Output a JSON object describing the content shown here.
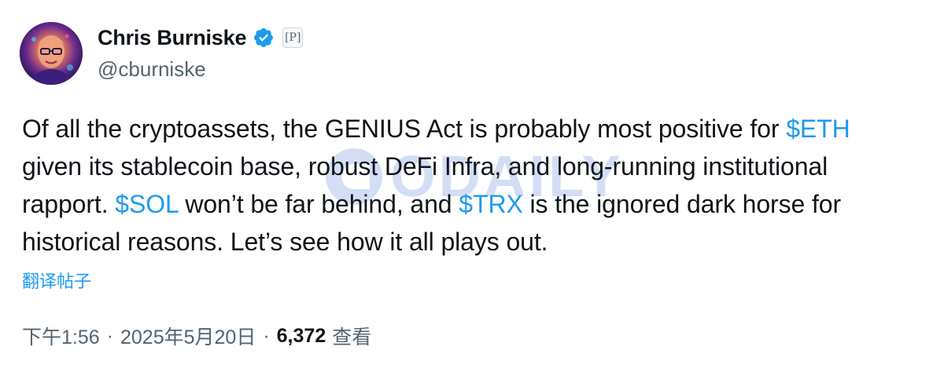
{
  "author": {
    "display_name": "Chris Burniske",
    "handle": "@cburniske",
    "badge_letter": "P",
    "avatar_icon": "profile-photo"
  },
  "tweet": {
    "segments": [
      {
        "text": "Of all the cryptoassets, the GENIUS Act is probably most positive for ",
        "type": "text"
      },
      {
        "text": "$ETH",
        "type": "cashtag"
      },
      {
        "text": " given its stablecoin base, robust DeFi Infra, and long-running institutional rapport. ",
        "type": "text"
      },
      {
        "text": "$SOL",
        "type": "cashtag"
      },
      {
        "text": " won’t be far behind, and ",
        "type": "text"
      },
      {
        "text": "$TRX",
        "type": "cashtag"
      },
      {
        "text": " is the ignored dark horse for historical reasons. Let’s see how it all plays out.",
        "type": "text"
      }
    ],
    "translate_label": "翻译帖子",
    "time": "下午1:56",
    "separator": "·",
    "date": "2025年5月20日",
    "views_count": "6,372",
    "views_label": "查看"
  },
  "watermark": {
    "text": "ODAILY"
  },
  "colors": {
    "link": "#1d9bf0",
    "text": "#0f1419",
    "secondary": "#536471",
    "verified": "#1d9bf0"
  }
}
